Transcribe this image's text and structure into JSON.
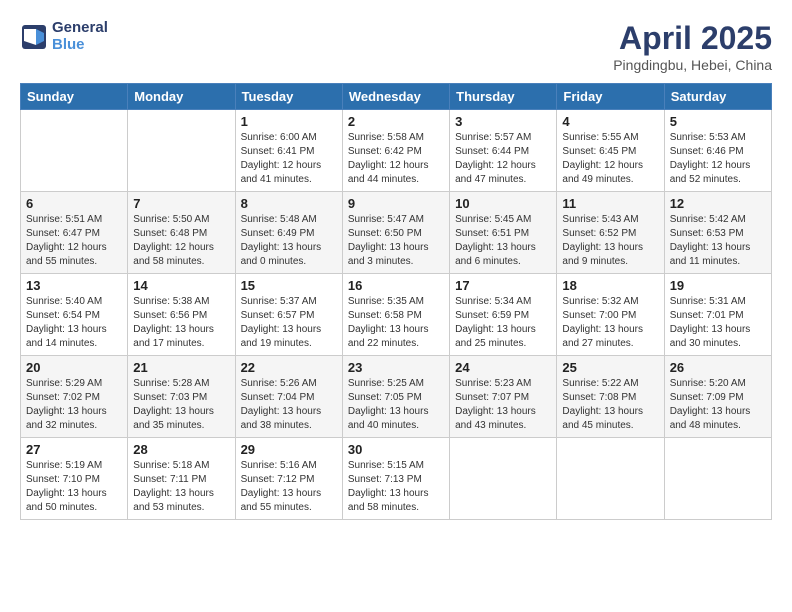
{
  "header": {
    "logo_line1": "General",
    "logo_line2": "Blue",
    "month_title": "April 2025",
    "subtitle": "Pingdingbu, Hebei, China"
  },
  "columns": [
    "Sunday",
    "Monday",
    "Tuesday",
    "Wednesday",
    "Thursday",
    "Friday",
    "Saturday"
  ],
  "weeks": [
    [
      {
        "day": "",
        "text": ""
      },
      {
        "day": "",
        "text": ""
      },
      {
        "day": "1",
        "text": "Sunrise: 6:00 AM\nSunset: 6:41 PM\nDaylight: 12 hours\nand 41 minutes."
      },
      {
        "day": "2",
        "text": "Sunrise: 5:58 AM\nSunset: 6:42 PM\nDaylight: 12 hours\nand 44 minutes."
      },
      {
        "day": "3",
        "text": "Sunrise: 5:57 AM\nSunset: 6:44 PM\nDaylight: 12 hours\nand 47 minutes."
      },
      {
        "day": "4",
        "text": "Sunrise: 5:55 AM\nSunset: 6:45 PM\nDaylight: 12 hours\nand 49 minutes."
      },
      {
        "day": "5",
        "text": "Sunrise: 5:53 AM\nSunset: 6:46 PM\nDaylight: 12 hours\nand 52 minutes."
      }
    ],
    [
      {
        "day": "6",
        "text": "Sunrise: 5:51 AM\nSunset: 6:47 PM\nDaylight: 12 hours\nand 55 minutes."
      },
      {
        "day": "7",
        "text": "Sunrise: 5:50 AM\nSunset: 6:48 PM\nDaylight: 12 hours\nand 58 minutes."
      },
      {
        "day": "8",
        "text": "Sunrise: 5:48 AM\nSunset: 6:49 PM\nDaylight: 13 hours\nand 0 minutes."
      },
      {
        "day": "9",
        "text": "Sunrise: 5:47 AM\nSunset: 6:50 PM\nDaylight: 13 hours\nand 3 minutes."
      },
      {
        "day": "10",
        "text": "Sunrise: 5:45 AM\nSunset: 6:51 PM\nDaylight: 13 hours\nand 6 minutes."
      },
      {
        "day": "11",
        "text": "Sunrise: 5:43 AM\nSunset: 6:52 PM\nDaylight: 13 hours\nand 9 minutes."
      },
      {
        "day": "12",
        "text": "Sunrise: 5:42 AM\nSunset: 6:53 PM\nDaylight: 13 hours\nand 11 minutes."
      }
    ],
    [
      {
        "day": "13",
        "text": "Sunrise: 5:40 AM\nSunset: 6:54 PM\nDaylight: 13 hours\nand 14 minutes."
      },
      {
        "day": "14",
        "text": "Sunrise: 5:38 AM\nSunset: 6:56 PM\nDaylight: 13 hours\nand 17 minutes."
      },
      {
        "day": "15",
        "text": "Sunrise: 5:37 AM\nSunset: 6:57 PM\nDaylight: 13 hours\nand 19 minutes."
      },
      {
        "day": "16",
        "text": "Sunrise: 5:35 AM\nSunset: 6:58 PM\nDaylight: 13 hours\nand 22 minutes."
      },
      {
        "day": "17",
        "text": "Sunrise: 5:34 AM\nSunset: 6:59 PM\nDaylight: 13 hours\nand 25 minutes."
      },
      {
        "day": "18",
        "text": "Sunrise: 5:32 AM\nSunset: 7:00 PM\nDaylight: 13 hours\nand 27 minutes."
      },
      {
        "day": "19",
        "text": "Sunrise: 5:31 AM\nSunset: 7:01 PM\nDaylight: 13 hours\nand 30 minutes."
      }
    ],
    [
      {
        "day": "20",
        "text": "Sunrise: 5:29 AM\nSunset: 7:02 PM\nDaylight: 13 hours\nand 32 minutes."
      },
      {
        "day": "21",
        "text": "Sunrise: 5:28 AM\nSunset: 7:03 PM\nDaylight: 13 hours\nand 35 minutes."
      },
      {
        "day": "22",
        "text": "Sunrise: 5:26 AM\nSunset: 7:04 PM\nDaylight: 13 hours\nand 38 minutes."
      },
      {
        "day": "23",
        "text": "Sunrise: 5:25 AM\nSunset: 7:05 PM\nDaylight: 13 hours\nand 40 minutes."
      },
      {
        "day": "24",
        "text": "Sunrise: 5:23 AM\nSunset: 7:07 PM\nDaylight: 13 hours\nand 43 minutes."
      },
      {
        "day": "25",
        "text": "Sunrise: 5:22 AM\nSunset: 7:08 PM\nDaylight: 13 hours\nand 45 minutes."
      },
      {
        "day": "26",
        "text": "Sunrise: 5:20 AM\nSunset: 7:09 PM\nDaylight: 13 hours\nand 48 minutes."
      }
    ],
    [
      {
        "day": "27",
        "text": "Sunrise: 5:19 AM\nSunset: 7:10 PM\nDaylight: 13 hours\nand 50 minutes."
      },
      {
        "day": "28",
        "text": "Sunrise: 5:18 AM\nSunset: 7:11 PM\nDaylight: 13 hours\nand 53 minutes."
      },
      {
        "day": "29",
        "text": "Sunrise: 5:16 AM\nSunset: 7:12 PM\nDaylight: 13 hours\nand 55 minutes."
      },
      {
        "day": "30",
        "text": "Sunrise: 5:15 AM\nSunset: 7:13 PM\nDaylight: 13 hours\nand 58 minutes."
      },
      {
        "day": "",
        "text": ""
      },
      {
        "day": "",
        "text": ""
      },
      {
        "day": "",
        "text": ""
      }
    ]
  ]
}
